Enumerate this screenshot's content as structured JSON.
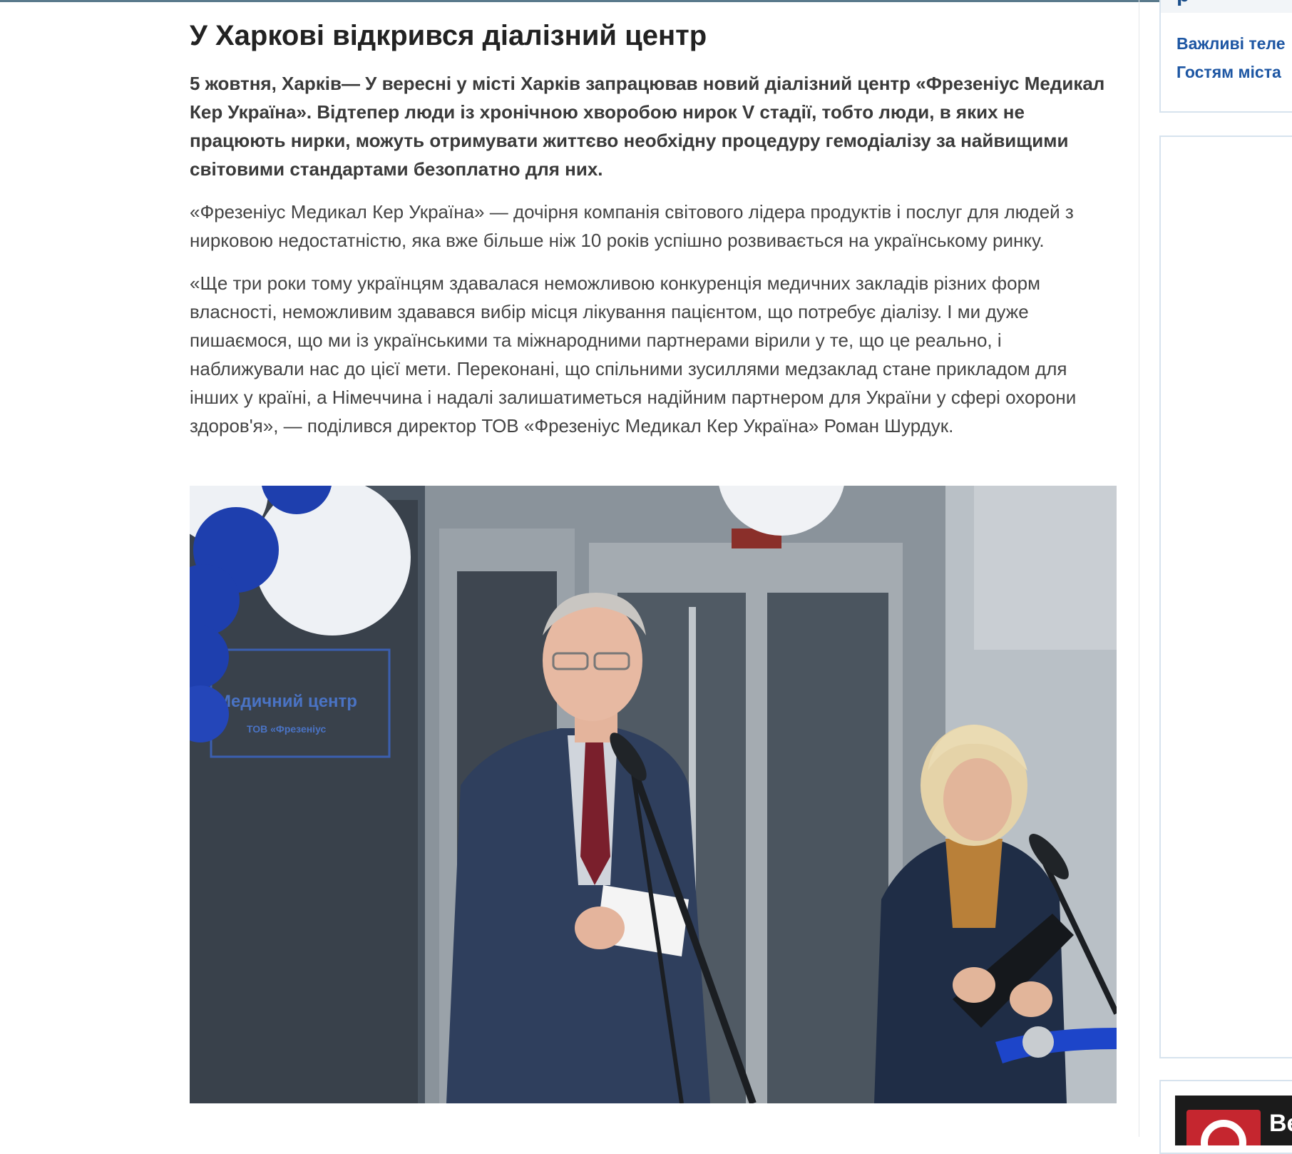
{
  "article": {
    "title": "У Харкові відкрився діалізний центр",
    "lead": "5 жовтня, Харків— У вересні у місті Харків запрацював новий діалізний центр «Фрезеніус Медикал Кер Україна». Відтепер люди із хронічною хворобою нирок V стадії, тобто люди, в яких не працюють нирки, можуть отримувати життєво необхідну процедуру гемодіалізу за найвищими світовими стандартами безоплатно для них.",
    "paragraphs": [
      "«Фрезеніус Медикал Кер Україна» — дочірня компанія світового лідера продуктів і послуг для людей з нирковою недостатністю, яка вже більше ніж 10 років успішно розвивається на українському ринку.",
      "«Ще три роки тому українцям здавалася неможливою конкуренція медичних закладів різних форм власності, неможливим здавався вибір місця лікування пацієнтом, що потребує діалізу. І ми дуже пишаємося, що ми із українськими та міжнародними партнерами вірили у те, що це реально, і наближували нас до цієї мети. Переконані, що спільними зусиллями медзаклад стане прикладом для інших у країні, а Німеччина і надалі залишатиметься надійним партнером для України у сфері охорони здоров'я», — поділився директор ТОВ «Фрезеніус Медикал Кер Україна» Роман Шурдук."
    ],
    "photo": {
      "sign_line1": "Медичний центр",
      "sign_line2": "ТОВ «Фрезеніус"
    }
  },
  "sidebar": {
    "links": [
      "Важливі теле",
      "Гостям міста"
    ],
    "ad_text": "Be"
  },
  "colors": {
    "link": "#1d56a3",
    "border": "#d7e3ee",
    "balloon_blue": "#1e3fae"
  }
}
